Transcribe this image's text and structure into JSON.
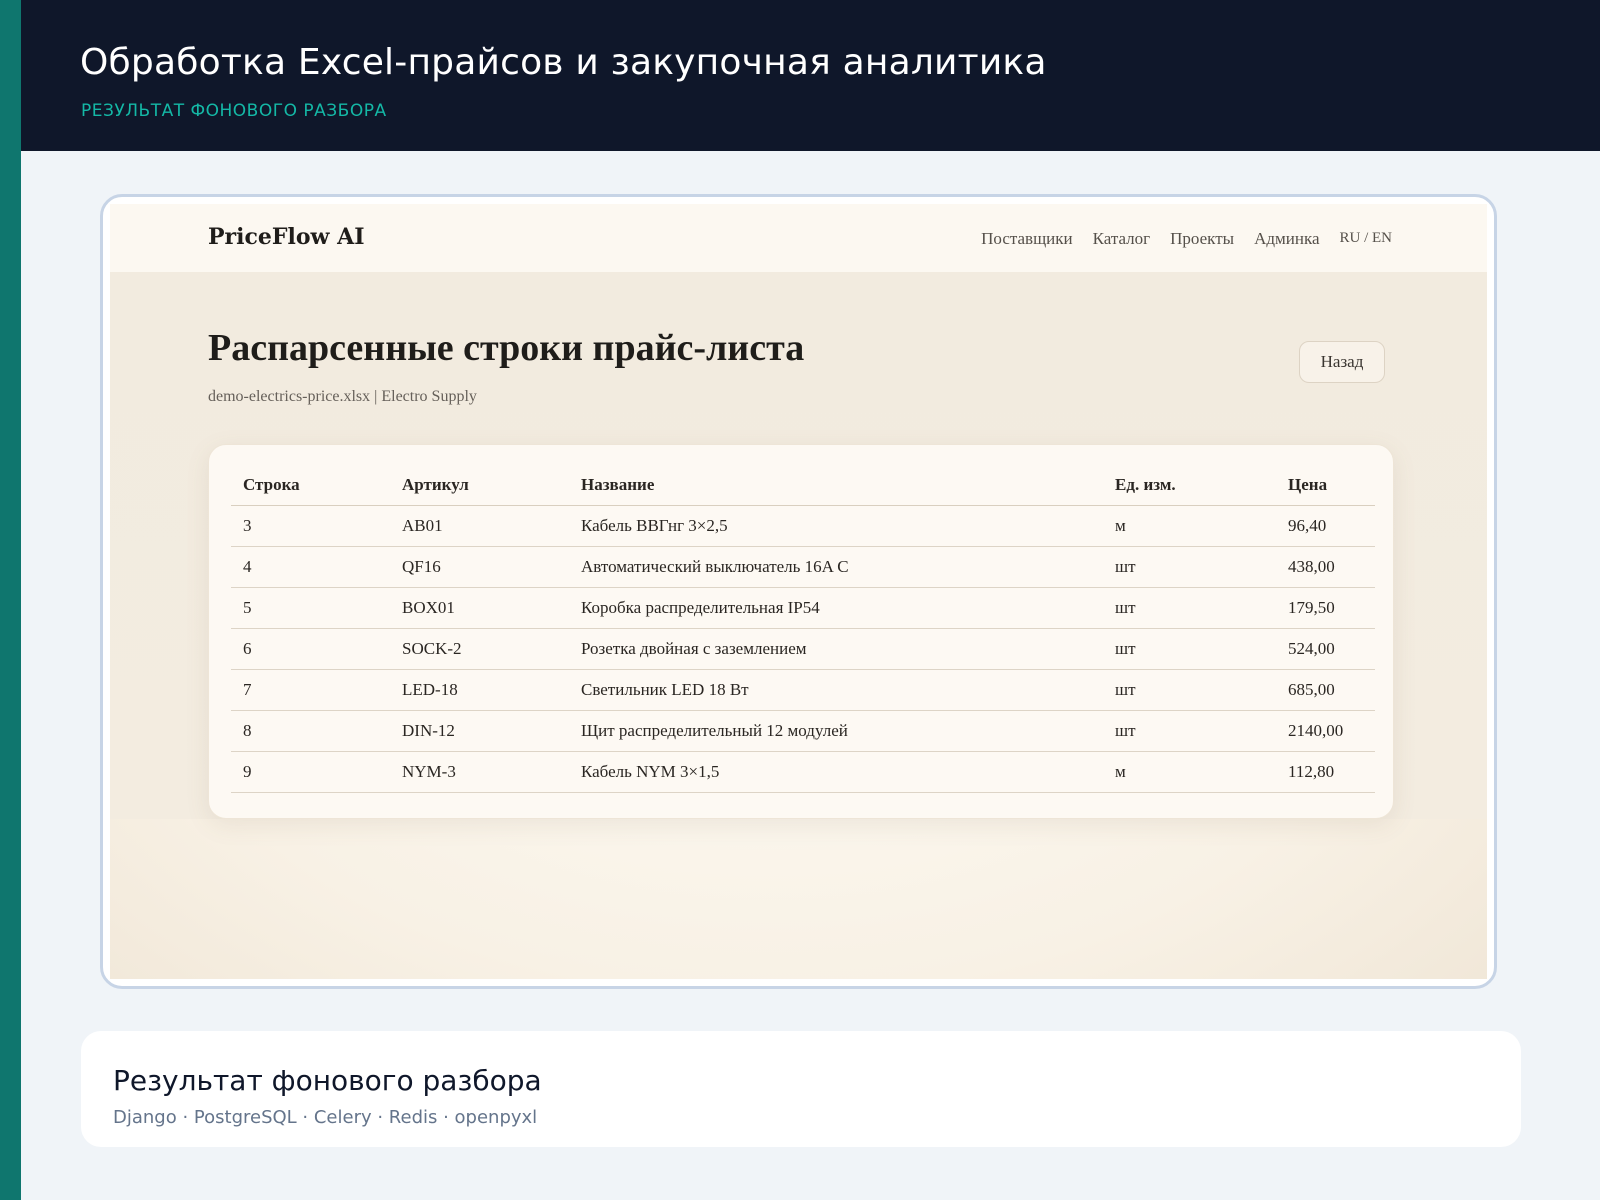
{
  "header": {
    "title": "Обработка Excel-прайсов и закупочная аналитика",
    "subtitle": "РЕЗУЛЬТАТ ФОНОВОГО РАЗБОРА"
  },
  "app": {
    "brand": "PriceFlow AI",
    "nav": {
      "suppliers": "Поставщики",
      "catalog": "Каталог",
      "projects": "Проекты",
      "admin": "Админка",
      "lang": "RU / EN"
    },
    "page_title": "Распарсенные строки прайс-листа",
    "meta": "demo-electrics-price.xlsx | Electro Supply",
    "back_label": "Назад",
    "table": {
      "columns": [
        "Строка",
        "Артикул",
        "Название",
        "Ед. изм.",
        "Цена"
      ],
      "rows": [
        [
          "3",
          "AB01",
          "Кабель ВВГнг 3×2,5",
          "м",
          "96,40"
        ],
        [
          "4",
          "QF16",
          "Автоматический выключатель 16A C",
          "шт",
          "438,00"
        ],
        [
          "5",
          "BOX01",
          "Коробка распределительная IP54",
          "шт",
          "179,50"
        ],
        [
          "6",
          "SOCK-2",
          "Розетка двойная с заземлением",
          "шт",
          "524,00"
        ],
        [
          "7",
          "LED-18",
          "Светильник LED 18 Вт",
          "шт",
          "685,00"
        ],
        [
          "8",
          "DIN-12",
          "Щит распределительный 12 модулей",
          "шт",
          "2140,00"
        ],
        [
          "9",
          "NYM-3",
          "Кабель NYM 3×1,5",
          "м",
          "112,80"
        ]
      ]
    }
  },
  "info": {
    "title": "Результат фонового разбора",
    "stack": "Django · PostgreSQL · Celery · Redis · openpyxl"
  }
}
